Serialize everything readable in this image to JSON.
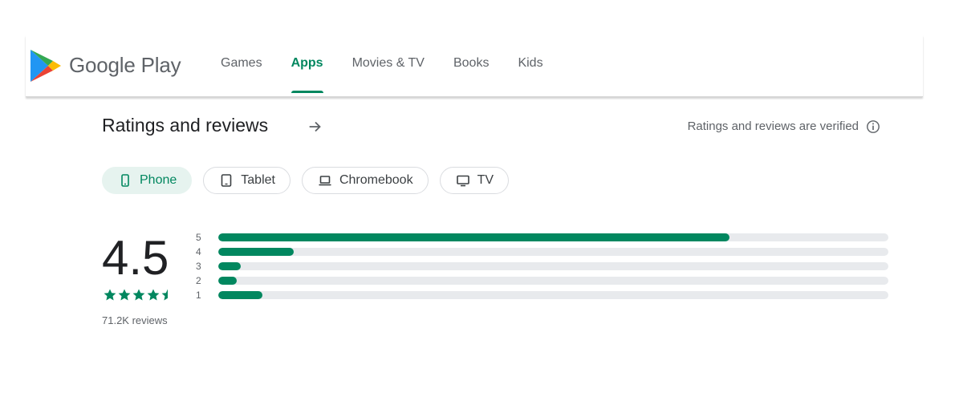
{
  "header": {
    "brand": "Google Play",
    "nav": [
      {
        "label": "Games",
        "active": false
      },
      {
        "label": "Apps",
        "active": true
      },
      {
        "label": "Movies & TV",
        "active": false
      },
      {
        "label": "Books",
        "active": false
      },
      {
        "label": "Kids",
        "active": false
      }
    ]
  },
  "ratings": {
    "title": "Ratings and reviews",
    "verified_text": "Ratings and reviews are verified",
    "devices": [
      {
        "label": "Phone",
        "icon": "phone-icon",
        "selected": true
      },
      {
        "label": "Tablet",
        "icon": "tablet-icon",
        "selected": false
      },
      {
        "label": "Chromebook",
        "icon": "laptop-icon",
        "selected": false
      },
      {
        "label": "TV",
        "icon": "tv-icon",
        "selected": false
      }
    ],
    "score": "4.5",
    "stars_value": 4.5,
    "review_count": "71.2K reviews",
    "histogram": [
      {
        "stars": "5",
        "fraction": 0.763
      },
      {
        "stars": "4",
        "fraction": 0.112
      },
      {
        "stars": "3",
        "fraction": 0.033
      },
      {
        "stars": "2",
        "fraction": 0.027
      },
      {
        "stars": "1",
        "fraction": 0.066
      }
    ]
  },
  "colors": {
    "accent": "#01875f",
    "track": "#e8eaed",
    "chip_selected_bg": "#e6f3ef"
  }
}
